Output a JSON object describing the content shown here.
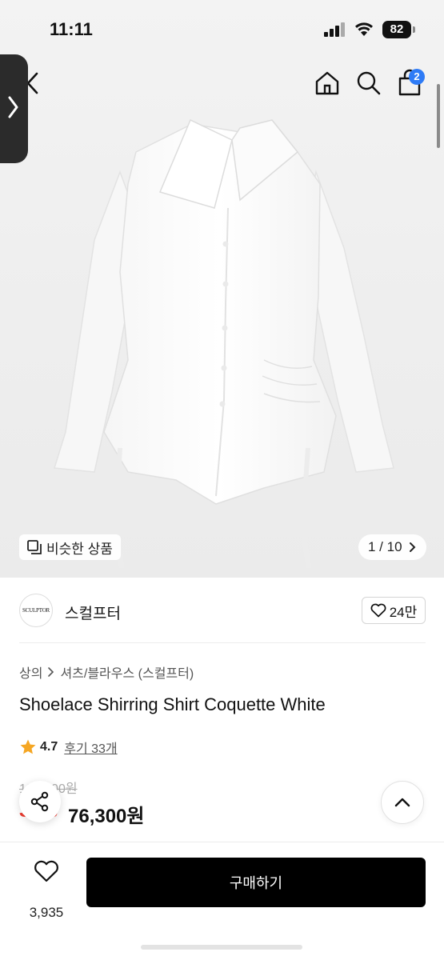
{
  "status_bar": {
    "time": "11:11",
    "battery": "82"
  },
  "nav": {
    "cart_count": "2",
    "icons": [
      "back-icon",
      "home-icon",
      "search-icon",
      "cart-icon"
    ]
  },
  "image_overlay": {
    "similar_label": "비슷한 상품",
    "page_counter": "1 / 10"
  },
  "brand": {
    "logo_text": "SCULPTOR",
    "name": "스컬프터",
    "likes": "24만"
  },
  "breadcrumb": {
    "level1": "상의",
    "level2": "셔츠/블라우스 (스컬프터)"
  },
  "product": {
    "title": "Shoelace Shirring Shirt Coquette White",
    "rating": "4.7",
    "review_label": "후기 33개",
    "original_price": "109,000원",
    "discount": "30%",
    "sale_price": "76,300원"
  },
  "bottom_bar": {
    "wish_count": "3,935",
    "buy_label": "구매하기"
  },
  "colors": {
    "accent": "#2e7bf6",
    "discount": "#f03a2e",
    "star": "#f5a623",
    "buy_button": "#000000"
  }
}
